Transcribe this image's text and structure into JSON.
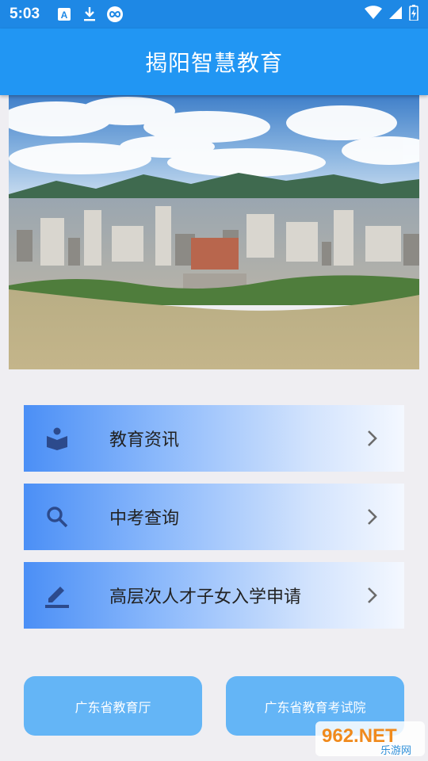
{
  "status_bar": {
    "time": "5:03",
    "left_icons": [
      "font-a-icon",
      "download-icon",
      "sync-icon"
    ],
    "right_icons": [
      "wifi-icon",
      "signal-icon",
      "battery-icon"
    ]
  },
  "app_bar": {
    "title": "揭阳智慧教育"
  },
  "banner": {
    "description_icon": "city-panorama-image"
  },
  "menu": [
    {
      "label": "教育资讯",
      "icon": "book-reader-icon"
    },
    {
      "label": "中考查询",
      "icon": "search-icon"
    },
    {
      "label": "高层次人才子女入学申请",
      "icon": "edit-pen-icon"
    }
  ],
  "links": [
    {
      "label": "广东省教育厅"
    },
    {
      "label": "广东省教育考试院"
    }
  ],
  "watermark": {
    "brand": "962.NET",
    "sub": "乐游网"
  },
  "colors": {
    "status_bar": "#1e88e5",
    "app_bar": "#2196f3",
    "link_button": "#64b5f6",
    "page_bg": "#efeef2"
  }
}
